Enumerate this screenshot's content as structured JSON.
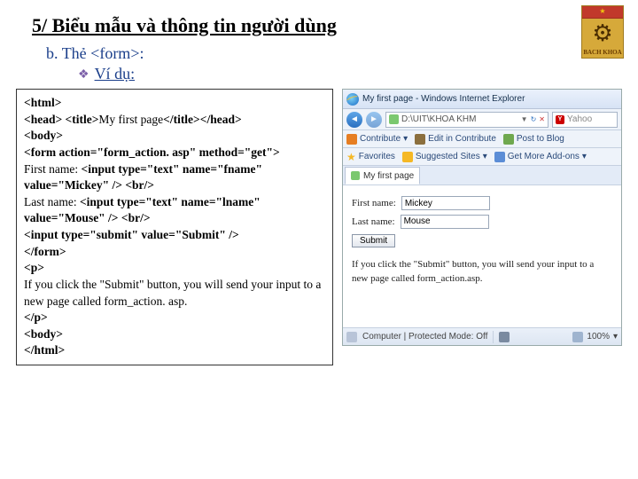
{
  "heading": "5/ Biểu mẫu và thông tin người dùng",
  "sub_b_prefix": "b.",
  "sub_b_text": "Thẻ <form>:",
  "sub_vi_text": "Ví dụ:",
  "badge": {
    "label": "BACH KHOA"
  },
  "code": {
    "l1": "<html>",
    "l2a": "<head> <title>",
    "l2b": "My first page",
    "l2c": "</title></head>",
    "l3": "<body>",
    "l4": "<form action=\"form_action. asp\" method=\"get\">",
    "l5a": "First name: ",
    "l5b": "<input type=\"text\" name=\"fname\" value=\"Mickey\" /> <br/>",
    "l6a": "Last name: ",
    "l6b": "<input type=\"text\" name=\"lname\" value=\"Mouse\" /> <br/>",
    "l7": "<input type=\"submit\" value=\"Submit\" />",
    "l8": "</form>",
    "l9": "<p>",
    "l10": "If you click the \"Submit\" button, you will send your input to a new page called form_action. asp.",
    "l11": "</p>",
    "l12": "<body>",
    "l13": "</html>"
  },
  "browser": {
    "title": "My first page - Windows Internet Explorer",
    "address": "D:\\UIT\\KHOA KHM",
    "search_engine": "Yahoo",
    "toolbar": {
      "contribute": "Contribute",
      "edit": "Edit in Contribute",
      "post": "Post to Blog"
    },
    "favbar": {
      "favorites": "Favorites",
      "suggested": "Suggested Sites",
      "addons": "Get More Add-ons"
    },
    "tab": "My first page",
    "body": {
      "fname_label": "First name:",
      "fname_value": "Mickey",
      "lname_label": "Last name:",
      "lname_value": "Mouse",
      "submit": "Submit",
      "para": "If you click the \"Submit\" button, you will send your input to a new page called form_action.asp."
    },
    "status": {
      "mode": "Computer | Protected Mode: Off",
      "zoom": "100%"
    }
  }
}
